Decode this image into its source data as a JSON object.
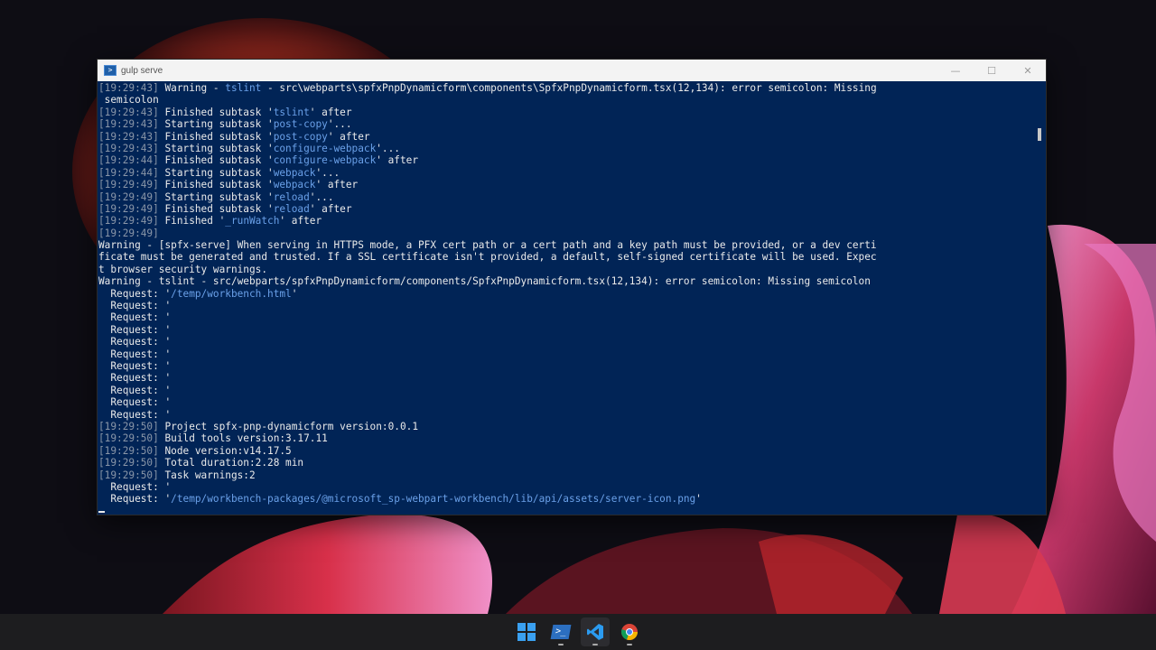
{
  "window": {
    "title": "gulp serve",
    "controls": {
      "minimize": "—",
      "maximize": "☐",
      "close": "✕"
    }
  },
  "console": {
    "lines": [
      [
        [
          "ts",
          "[19:29:43]"
        ],
        [
          "t",
          " Warning - "
        ],
        [
          "hl",
          "tslint"
        ],
        [
          "t",
          " - src\\webparts\\spfxPnpDynamicform\\components\\SpfxPnpDynamicform.tsx(12,134): error semicolon: Missing"
        ]
      ],
      [
        [
          "t",
          " semicolon"
        ]
      ],
      [
        [
          "ts",
          "[19:29:43]"
        ],
        [
          "t",
          " Finished subtask '"
        ],
        [
          "hl",
          "tslint"
        ],
        [
          "t",
          "' after"
        ]
      ],
      [
        [
          "ts",
          "[19:29:43]"
        ],
        [
          "t",
          " Starting subtask '"
        ],
        [
          "hl",
          "post-copy"
        ],
        [
          "t",
          "'..."
        ]
      ],
      [
        [
          "ts",
          "[19:29:43]"
        ],
        [
          "t",
          " Finished subtask '"
        ],
        [
          "hl",
          "post-copy"
        ],
        [
          "t",
          "' after"
        ]
      ],
      [
        [
          "ts",
          "[19:29:43]"
        ],
        [
          "t",
          " Starting subtask '"
        ],
        [
          "hl",
          "configure-webpack"
        ],
        [
          "t",
          "'..."
        ]
      ],
      [
        [
          "ts",
          "[19:29:44]"
        ],
        [
          "t",
          " Finished subtask '"
        ],
        [
          "hl",
          "configure-webpack"
        ],
        [
          "t",
          "' after"
        ]
      ],
      [
        [
          "ts",
          "[19:29:44]"
        ],
        [
          "t",
          " Starting subtask '"
        ],
        [
          "hl",
          "webpack"
        ],
        [
          "t",
          "'..."
        ]
      ],
      [
        [
          "ts",
          "[19:29:49]"
        ],
        [
          "t",
          " Finished subtask '"
        ],
        [
          "hl",
          "webpack"
        ],
        [
          "t",
          "' after"
        ]
      ],
      [
        [
          "ts",
          "[19:29:49]"
        ],
        [
          "t",
          " Starting subtask '"
        ],
        [
          "hl",
          "reload"
        ],
        [
          "t",
          "'..."
        ]
      ],
      [
        [
          "ts",
          "[19:29:49]"
        ],
        [
          "t",
          " Finished subtask '"
        ],
        [
          "hl",
          "reload"
        ],
        [
          "t",
          "' after"
        ]
      ],
      [
        [
          "ts",
          "[19:29:49]"
        ],
        [
          "t",
          " Finished '"
        ],
        [
          "hl",
          "_runWatch"
        ],
        [
          "t",
          "' after"
        ]
      ],
      [
        [
          "ts",
          "[19:29:49]"
        ]
      ],
      [
        [
          "t",
          "Warning - [spfx-serve] When serving in HTTPS mode, a PFX cert path or a cert path and a key path must be provided, or a dev certi"
        ]
      ],
      [
        [
          "t",
          "ficate must be generated and trusted. If a SSL certificate isn't provided, a default, self-signed certificate will be used. Expec"
        ]
      ],
      [
        [
          "t",
          "t browser security warnings."
        ]
      ],
      [
        [
          "t",
          "Warning - tslint - src/webparts/spfxPnpDynamicform/components/SpfxPnpDynamicform.tsx(12,134): error semicolon: Missing semicolon"
        ]
      ],
      [
        [
          "t",
          "  Request: '"
        ],
        [
          "hl",
          "/temp/workbench.html"
        ],
        [
          "t",
          "'"
        ]
      ],
      [
        [
          "t",
          "  Request: '"
        ]
      ],
      [
        [
          "t",
          "  Request: '"
        ]
      ],
      [
        [
          "t",
          "  Request: '"
        ]
      ],
      [
        [
          "t",
          "  Request: '"
        ]
      ],
      [
        [
          "t",
          "  Request: '"
        ]
      ],
      [
        [
          "t",
          "  Request: '"
        ]
      ],
      [
        [
          "t",
          "  Request: '"
        ]
      ],
      [
        [
          "t",
          "  Request: '"
        ]
      ],
      [
        [
          "t",
          "  Request: '"
        ]
      ],
      [
        [
          "t",
          "  Request: '"
        ]
      ],
      [
        [
          "ts",
          "[19:29:50]"
        ],
        [
          "t",
          " Project spfx-pnp-dynamicform version:0.0.1"
        ]
      ],
      [
        [
          "ts",
          "[19:29:50]"
        ],
        [
          "t",
          " Build tools version:3.17.11"
        ]
      ],
      [
        [
          "ts",
          "[19:29:50]"
        ],
        [
          "t",
          " Node version:v14.17.5"
        ]
      ],
      [
        [
          "ts",
          "[19:29:50]"
        ],
        [
          "t",
          " Total duration:2.28 min"
        ]
      ],
      [
        [
          "ts",
          "[19:29:50]"
        ],
        [
          "t",
          " Task warnings:2"
        ]
      ],
      [
        [
          "t",
          "  Request: '"
        ]
      ],
      [
        [
          "t",
          "  Request: '"
        ],
        [
          "hl",
          "/temp/workbench-packages/@microsoft_sp-webpart-workbench/lib/api/assets/server-icon.png"
        ],
        [
          "t",
          "'"
        ]
      ]
    ]
  },
  "taskbar": {
    "items": [
      {
        "name": "start-button",
        "icon": "windows-logo-icon",
        "running": false
      },
      {
        "name": "taskbar-powershell",
        "icon": "powershell-icon",
        "running": true
      },
      {
        "name": "taskbar-vscode",
        "icon": "vscode-icon",
        "running": true
      },
      {
        "name": "taskbar-chrome",
        "icon": "chrome-icon",
        "running": true
      }
    ]
  },
  "colors": {
    "console_bg": "#012456",
    "console_text": "#eaeaea",
    "timestamp": "#8a96a8",
    "highlight": "#6aa0e8",
    "taskbar_bg": "#1d1d1f"
  }
}
